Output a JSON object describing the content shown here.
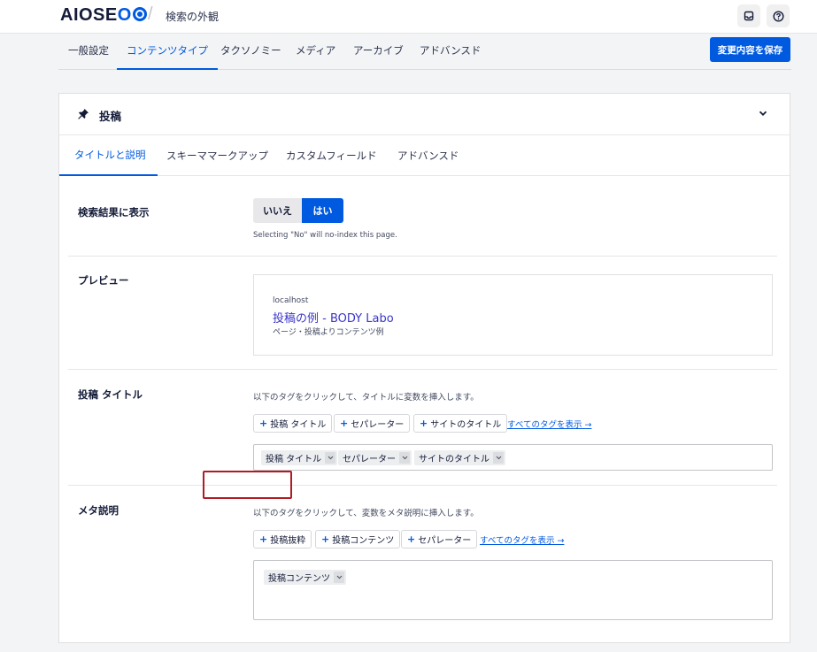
{
  "header": {
    "logo_main": "AIOSE",
    "logo_accent": "O",
    "breadcrumb": "検索の外観",
    "inbox_icon": "inbox-icon",
    "help_icon": "help-icon"
  },
  "nav": {
    "tabs": [
      {
        "label": "一般設定"
      },
      {
        "label": "コンテンツタイプ",
        "active": true
      },
      {
        "label": "タクソノミー"
      },
      {
        "label": "メディア"
      },
      {
        "label": "アーカイブ"
      },
      {
        "label": "アドバンスド"
      }
    ],
    "save_label": "変更内容を保存"
  },
  "card": {
    "title": "投稿",
    "pin_icon": "pin-icon",
    "collapse_icon": "chevron-down-icon",
    "tabs": [
      {
        "label": "タイトルと説明",
        "active": true
      },
      {
        "label": "スキーママークアップ"
      },
      {
        "label": "カスタムフィールド"
      },
      {
        "label": "アドバンスド"
      }
    ],
    "show_in_search": {
      "label": "検索結果に表示",
      "no_label": "いいえ",
      "yes_label": "はい",
      "selected": "はい",
      "hint": "Selecting \"No\" will no-index this page."
    },
    "preview": {
      "label": "プレビュー",
      "host": "localhost",
      "title": "投稿の例 - BODY Labo",
      "description": "ページ・投稿よりコンテンツ例"
    },
    "post_title": {
      "label": "投稿 タイトル",
      "instruction": "以下のタグをクリックして、タイトルに変数を挿入します。",
      "tag_buttons": [
        "投稿 タイトル",
        "セパレーター",
        "サイトのタイトル"
      ],
      "all_tags_link": "すべてのタグを表示 →",
      "chips": [
        "投稿 タイトル",
        "セパレーター",
        "サイトのタイトル"
      ]
    },
    "meta_description": {
      "label": "メタ説明",
      "instruction": "以下のタグをクリックして、変数をメタ説明に挿入します。",
      "tag_buttons": [
        "投稿抜粋",
        "投稿コンテンツ",
        "セパレーター"
      ],
      "all_tags_link": "すべてのタグを表示 →",
      "chips": [
        "投稿コンテンツ"
      ]
    },
    "highlight_color": "#b01c24"
  },
  "colors": {
    "accent": "#005ae0",
    "text": "#141b38",
    "preview_link": "#3b36c7"
  }
}
